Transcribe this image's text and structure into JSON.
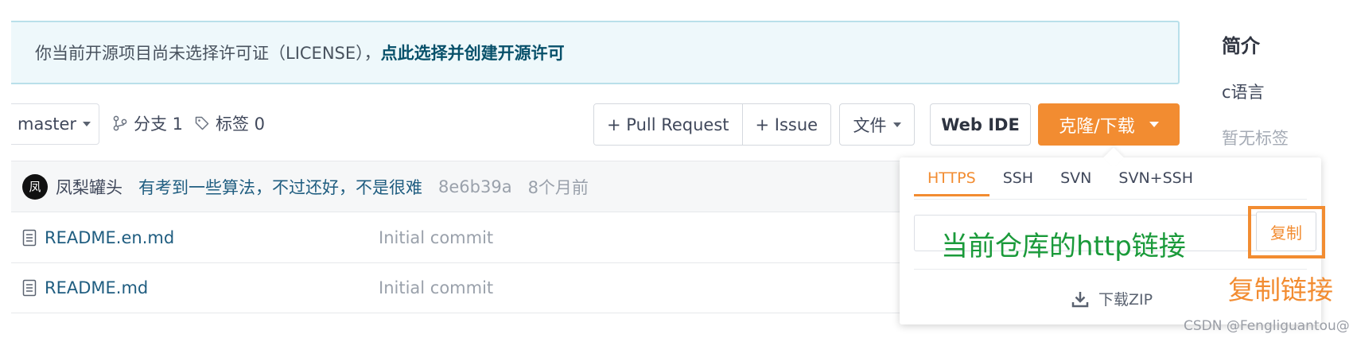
{
  "notice": {
    "text": "你当前开源项目尚未选择许可证（LICENSE），",
    "link": "点此选择并创建开源许可"
  },
  "sidebar": {
    "title": "简介",
    "language": "c语言",
    "tags": "暂无标签"
  },
  "toolbar": {
    "branch": "master",
    "branches": "分支 1",
    "tags": "标签 0",
    "pull_request": "+ Pull Request",
    "issue": "+ Issue",
    "files": "文件",
    "web_ide": "Web IDE",
    "clone": "克隆/下载"
  },
  "commit": {
    "avatar": "凤",
    "author": "凤梨罐头",
    "message": "有考到一些算法，不过还好，不是很难",
    "sha": "8e6b39a",
    "time": "8个月前"
  },
  "files": [
    {
      "name": "README.en.md",
      "commit": "Initial commit"
    },
    {
      "name": "README.md",
      "commit": "Initial commit"
    }
  ],
  "clone_panel": {
    "tabs": [
      "HTTPS",
      "SSH",
      "SVN",
      "SVN+SSH"
    ],
    "active_tab": "HTTPS",
    "copy": "复制",
    "download_zip": "下载ZIP"
  },
  "annotations": {
    "url_label": "当前仓库的http链接",
    "copy_label": "复制链接"
  },
  "watermark": "CSDN @Fengliguantou@",
  "colors": {
    "accent": "#f28c31",
    "link": "#1f5d80",
    "annotation_green": "#1a9a3a"
  }
}
